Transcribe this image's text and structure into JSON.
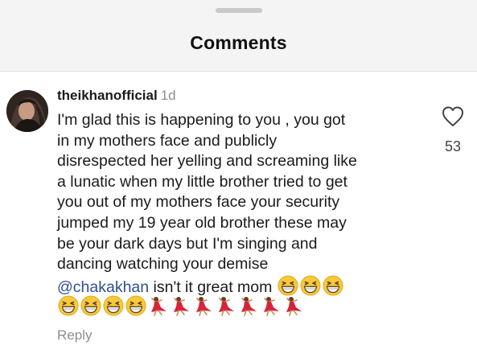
{
  "header": {
    "title": "Comments"
  },
  "comment": {
    "username": "theikhanofficial",
    "time": "1d",
    "lines": [
      "I'm glad this is happening to you , you got",
      "in my mothers face and publicly",
      "disrespected her yelling and screaming like",
      "a lunatic when my little brother tried to get",
      "you out of my mothers face your security",
      "jumped my 19 year old brother these may",
      "be your dark days but I'm singing and",
      "dancing watching your demise"
    ],
    "mention": "@chakakhan",
    "last_text": " isn't it great mom",
    "emoji_row1": [
      "grinning-squint-face",
      "grinning-squint-face",
      "grinning-squint-face"
    ],
    "emoji_row2": [
      "grinning-squint-face",
      "grinning-squint-face",
      "grinning-squint-face",
      "grinning-squint-face",
      "dancer",
      "dancer",
      "dancer",
      "dancer",
      "dancer",
      "dancer",
      "dancer"
    ]
  },
  "actions": {
    "reply_label": "Reply",
    "like_icon": "heart-outline-icon",
    "like_count": "53"
  }
}
